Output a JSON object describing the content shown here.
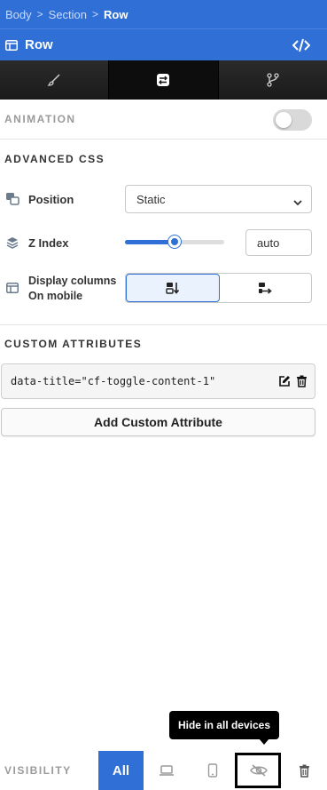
{
  "breadcrumb": {
    "items": [
      "Body",
      "Section",
      "Row"
    ]
  },
  "header": {
    "title": "Row"
  },
  "tabs": [
    {
      "name": "style",
      "icon": "brush-icon"
    },
    {
      "name": "settings",
      "icon": "sliders-toggle-icon",
      "active": true
    },
    {
      "name": "branch",
      "icon": "git-branch-icon"
    }
  ],
  "animation": {
    "label": "ANIMATION",
    "enabled": false
  },
  "advanced_css": {
    "label": "ADVANCED CSS",
    "position": {
      "label": "Position",
      "value": "Static"
    },
    "z_index": {
      "label": "Z Index",
      "value": "auto",
      "slider_fraction": 0.5
    },
    "display_columns": {
      "label_line1": "Display columns",
      "label_line2": "On mobile"
    }
  },
  "custom_attributes": {
    "label": "CUSTOM ATTRIBUTES",
    "items": [
      "data-title=\"cf-toggle-content-1\""
    ],
    "add_label": "Add Custom Attribute"
  },
  "tooltip": {
    "text": "Hide in all devices"
  },
  "visibility": {
    "label": "VISIBILITY",
    "all_label": "All"
  },
  "colors": {
    "accent": "#2f6fd6",
    "tab_dark": "#111111"
  }
}
